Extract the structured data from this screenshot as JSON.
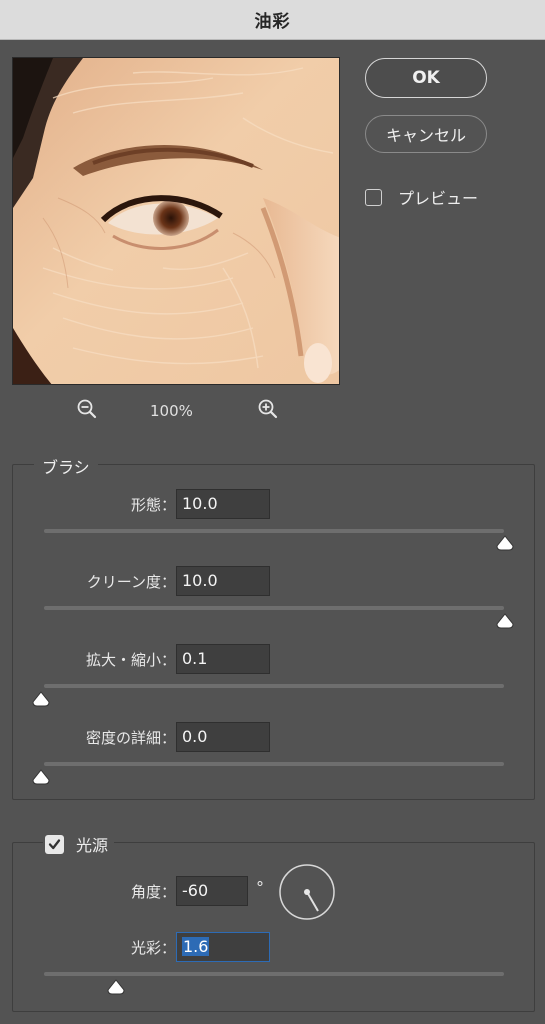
{
  "window": {
    "title": "油彩"
  },
  "buttons": {
    "ok": "OK",
    "cancel": "キャンセル"
  },
  "preview_toggle": {
    "label": "プレビュー",
    "checked": false
  },
  "zoom": {
    "level": "100%",
    "zoom_out_icon": "zoom-out-icon",
    "zoom_in_icon": "zoom-in-icon"
  },
  "brush": {
    "title": "ブラシ",
    "stylization": {
      "label": "形態：",
      "value": "10.0",
      "slider_fraction": 1.0
    },
    "cleanliness": {
      "label": "クリーン度：",
      "value": "10.0",
      "slider_fraction": 1.0
    },
    "scale": {
      "label": "拡大・縮小：",
      "value": "0.1",
      "slider_fraction": 0.0
    },
    "bristle_detail": {
      "label": "密度の詳細：",
      "value": "0.0",
      "slider_fraction": 0.0
    }
  },
  "lighting": {
    "title": "光源",
    "enabled": true,
    "angle": {
      "label": "角度：",
      "value": "-60",
      "unit": "°"
    },
    "shine": {
      "label": "光彩：",
      "value": "1.6",
      "slider_fraction": 0.16
    }
  },
  "colors": {
    "background": "#535353",
    "titlebar": "#dcdcdc",
    "selection": "#2d6bb5",
    "field": "#3f3f3f"
  }
}
